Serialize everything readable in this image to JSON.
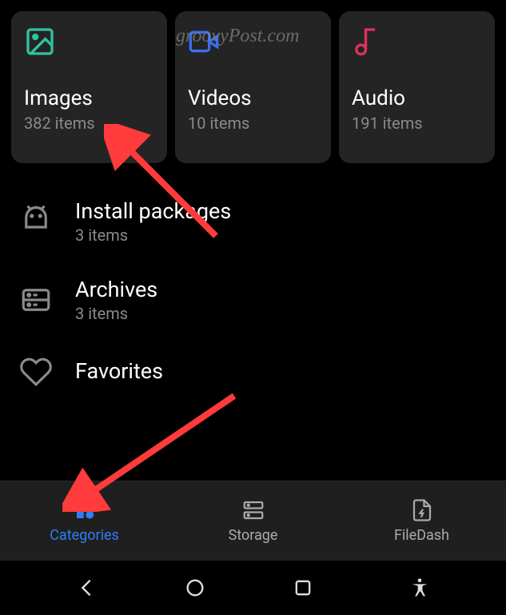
{
  "watermark": "groovyPost.com",
  "cards": [
    {
      "title": "Images",
      "count": "382 items"
    },
    {
      "title": "Videos",
      "count": "10 items"
    },
    {
      "title": "Audio",
      "count": "191 items"
    }
  ],
  "list": [
    {
      "title": "Install packages",
      "count": "3 items"
    },
    {
      "title": "Archives",
      "count": "3 items"
    },
    {
      "title": "Favorites",
      "count": ""
    }
  ],
  "nav": [
    {
      "label": "Categories"
    },
    {
      "label": "Storage"
    },
    {
      "label": "FileDash"
    }
  ]
}
